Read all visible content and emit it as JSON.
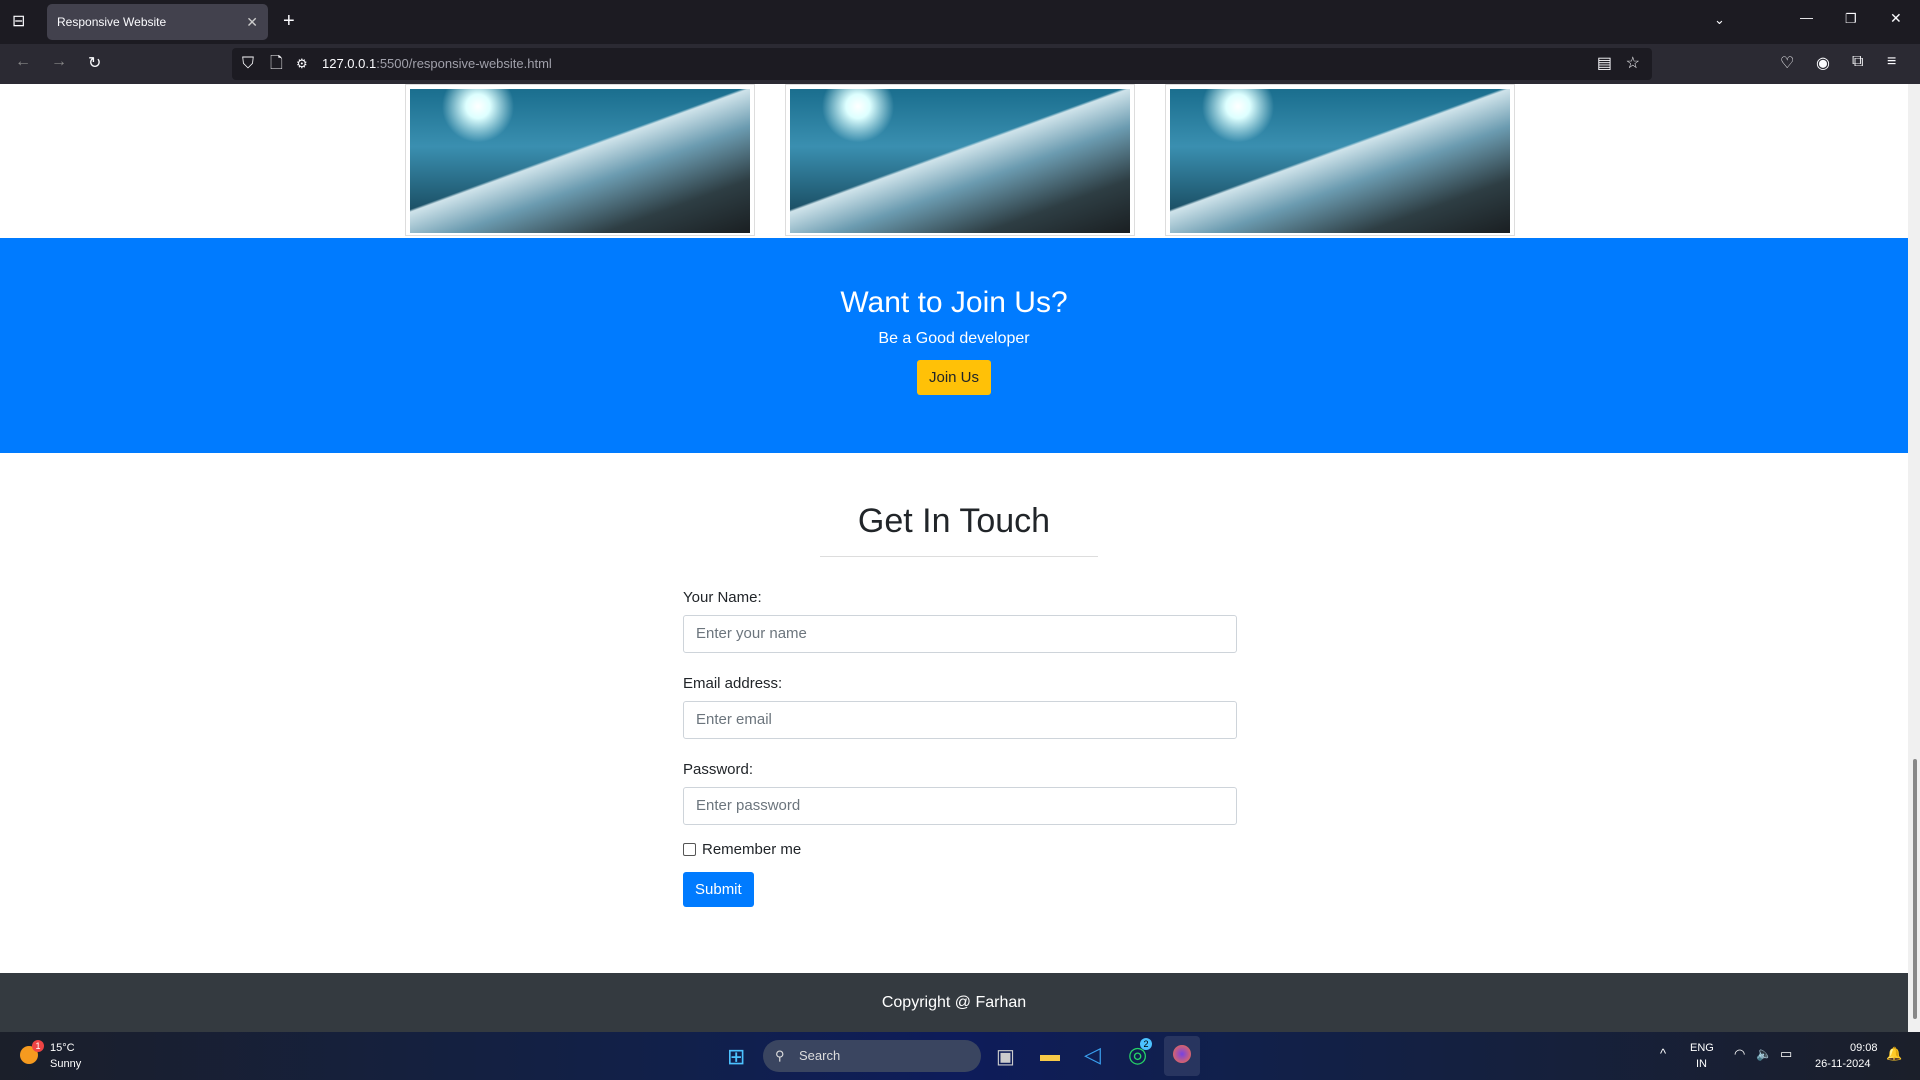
{
  "browser": {
    "tab_title": "Responsive Website",
    "url_host": "127.0.0.1",
    "url_rest": ":5500/responsive-website.html"
  },
  "hero": {
    "title": "Want to Join Us?",
    "subtitle": "Be a Good developer",
    "button": "Join Us"
  },
  "contact": {
    "title": "Get In Touch",
    "name_label": "Your Name:",
    "name_placeholder": "Enter your name",
    "email_label": "Email address:",
    "email_placeholder": "Enter email",
    "password_label": "Password:",
    "password_placeholder": "Enter password",
    "remember": "Remember me",
    "submit": "Submit"
  },
  "footer": {
    "text": "Copyright @ Farhan"
  },
  "taskbar": {
    "temp": "15°C",
    "weather": "Sunny",
    "weather_badge": "1",
    "search": "Search",
    "whatsapp_badge": "2",
    "lang1": "ENG",
    "lang2": "IN",
    "time": "09:08",
    "date": "26-11-2024"
  }
}
